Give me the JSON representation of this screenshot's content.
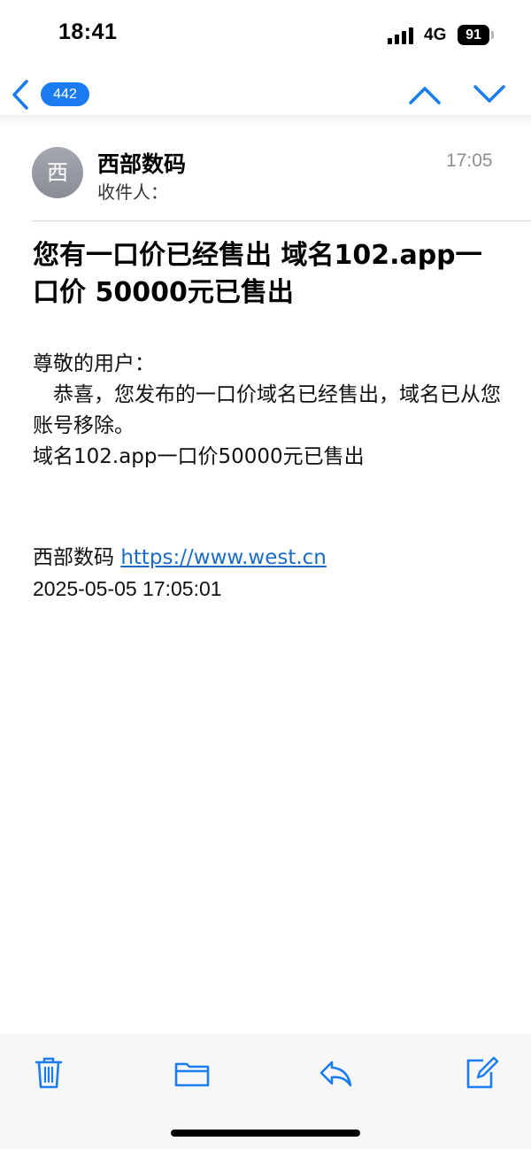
{
  "status_bar": {
    "time": "18:41",
    "network": "4G",
    "battery": "91"
  },
  "nav": {
    "unread_count": "442",
    "back_icon": "chevron-left-icon",
    "up_icon": "chevron-up-icon",
    "down_icon": "chevron-down-icon",
    "accent_color": "#1a7cf0"
  },
  "header": {
    "avatar_letter": "西",
    "sender": "西部数码",
    "recipient_label": "收件人：",
    "time": "17:05"
  },
  "subject": "您有一口价已经售出 域名102.app一口价 50000元已售出",
  "body": {
    "greeting": "尊敬的用户：",
    "message": "　恭喜，您发布的一口价域名已经售出，域名已从您账号移除。",
    "detail": "域名102.app一口价50000元已售出",
    "signature_name": "西部数码",
    "signature_link": "https://www.west.cn",
    "datetime": "2025-05-05 17:05:01"
  },
  "toolbar": {
    "icons": [
      "trash-icon",
      "folder-icon",
      "reply-icon",
      "compose-icon"
    ]
  }
}
